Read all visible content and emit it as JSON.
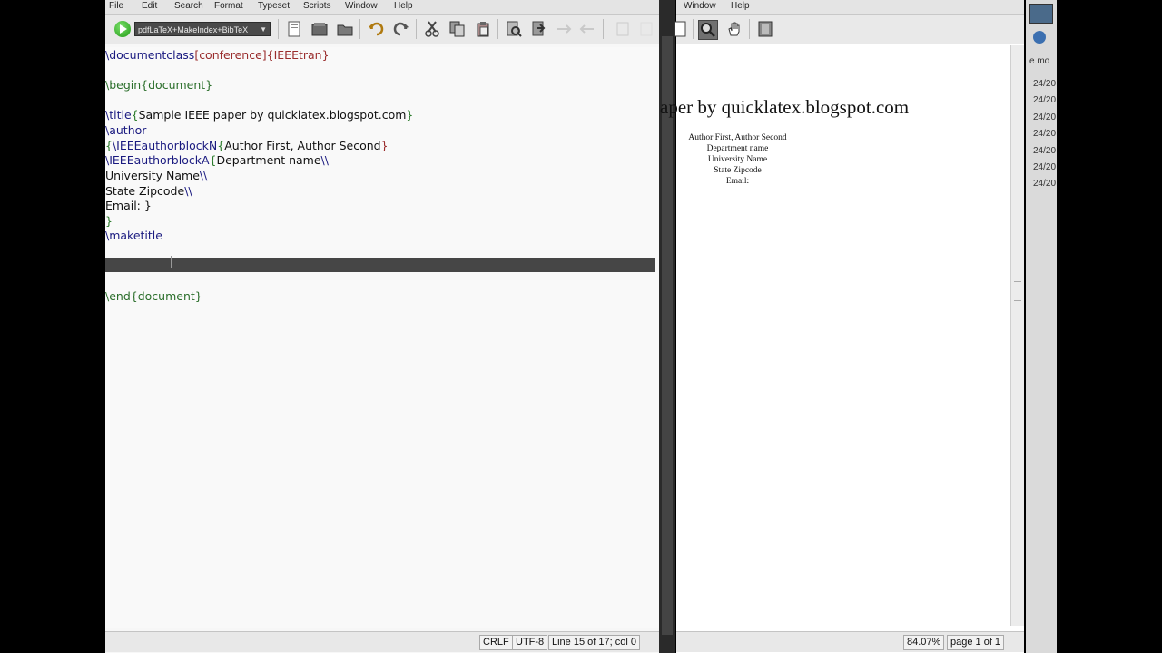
{
  "editor": {
    "menu": [
      "File",
      "Edit",
      "Search",
      "Format",
      "Typeset",
      "Scripts",
      "Window",
      "Help"
    ],
    "typeset_combo": "pdfLaTeX+MakeIndex+BibTeX",
    "code": {
      "line1": {
        "cmd": "\\documentclass",
        "arg1": "[conference]",
        "arg2": "{IEEEtran}"
      },
      "line3": {
        "cmd": "\\begin",
        "arg": "{document}"
      },
      "line5": {
        "cmd": "\\title",
        "open": "{",
        "text": "Sample IEEE paper by quicklatex.blogspot.com",
        "close": "}"
      },
      "line6": {
        "cmd": "\\author"
      },
      "line7": {
        "open": "{",
        "cmd": "\\IEEEauthorblockN",
        "open2": "{",
        "text": "Author First, Author Second",
        "close": "}"
      },
      "line8": {
        "cmd": "\\IEEEauthorblockA",
        "open": "{",
        "text": "Department name",
        "break": "\\\\"
      },
      "line9": {
        "text": "University Name",
        "break": "\\\\"
      },
      "line10": {
        "text": "State Zipcode",
        "break": "\\\\"
      },
      "line11": {
        "text": "Email: }"
      },
      "line12": {
        "text": "}"
      },
      "line13": {
        "cmd": "\\maketitle"
      },
      "line17": {
        "cmd": "\\end",
        "arg": "{document}"
      }
    },
    "status": {
      "line_ending": "CRLF",
      "encoding": "UTF-8",
      "position": "Line 15 of 17; col 0"
    }
  },
  "preview": {
    "menu": [
      "Window",
      "Help"
    ],
    "title_partial": "aper by quicklatex.blogspot.com",
    "authors": [
      "Author First, Author Second",
      "Department name",
      "University Name",
      "State Zipcode",
      "Email:"
    ],
    "status": {
      "zoom": "84.07%",
      "page": "page 1 of 1"
    }
  },
  "strip": {
    "text": "e mo",
    "dates": [
      "24/20",
      "24/20",
      "24/20",
      "24/20",
      "24/20",
      "24/20",
      "24/20"
    ]
  }
}
